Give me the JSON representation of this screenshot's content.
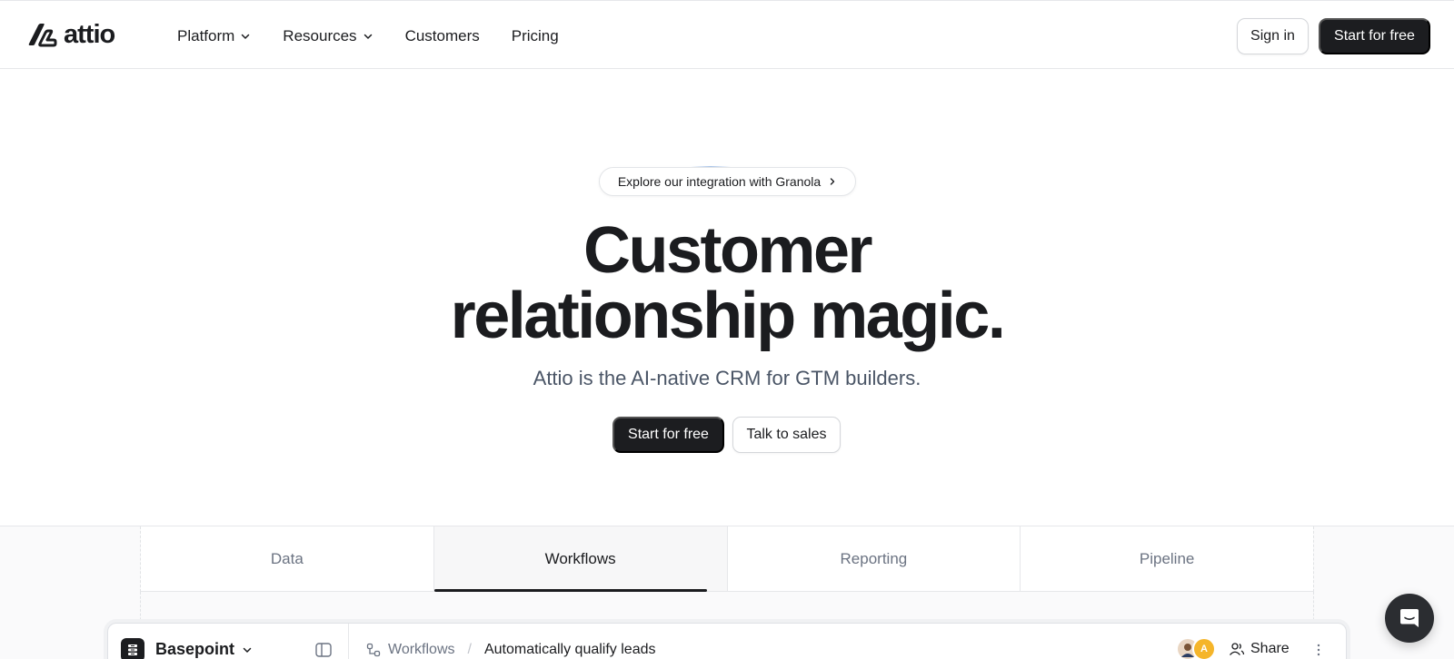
{
  "brand": {
    "name": "attio"
  },
  "nav": {
    "items": [
      {
        "label": "Platform",
        "has_dropdown": true
      },
      {
        "label": "Resources",
        "has_dropdown": true
      },
      {
        "label": "Customers",
        "has_dropdown": false
      },
      {
        "label": "Pricing",
        "has_dropdown": false
      }
    ],
    "signin_label": "Sign in",
    "start_label": "Start for free"
  },
  "hero": {
    "announcement": "Explore our integration with Granola",
    "title_line1": "Customer",
    "title_line2": "relationship magic.",
    "subtitle": "Attio is the AI-native CRM for GTM builders.",
    "primary_cta": "Start for free",
    "secondary_cta": "Talk to sales"
  },
  "product_tabs": {
    "items": [
      "Data",
      "Workflows",
      "Reporting",
      "Pipeline"
    ],
    "active": "Workflows"
  },
  "app_preview": {
    "workspace": "Basepoint",
    "breadcrumb_section": "Workflows",
    "breadcrumb_current": "Automatically qualify leads",
    "avatar_initial": "A",
    "share_label": "Share"
  },
  "colors": {
    "primary_button": "#1c1d20",
    "text": "#1b1c1f",
    "muted_text": "#6b7382",
    "border": "#e6e7ea"
  }
}
